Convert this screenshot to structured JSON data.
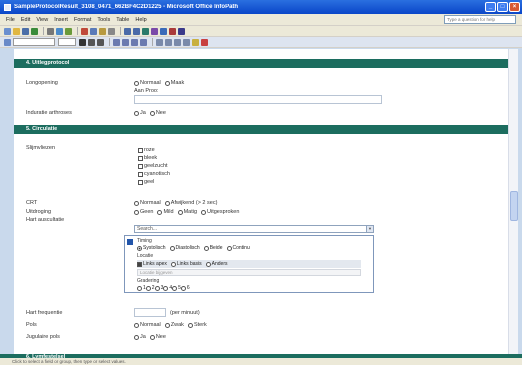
{
  "window": {
    "title": "SampleProtocolResult_3108_0471_662BF4C2D1225 - Microsoft Office InfoPath"
  },
  "menu": {
    "items": [
      "File",
      "Edit",
      "View",
      "Insert",
      "Format",
      "Tools",
      "Table",
      "Help"
    ],
    "help_placeholder": "Type a question for help"
  },
  "sections": {
    "s4": "4. Uitlegprotocol",
    "s5": "5. Circulatie",
    "s6": "6. Lymfestelsel"
  },
  "fields": {
    "longopening": {
      "label": "Longopening",
      "options": [
        "Normaal",
        "Maak"
      ],
      "extra_label": "Aan Proo:"
    },
    "induratie": {
      "label": "Induratie arthroses",
      "options": [
        "Ja",
        "Nee"
      ]
    },
    "slijmvliezen": {
      "label": "Slijmvliezen",
      "options": [
        "roze",
        "bleek",
        "geelzucht",
        "cyanotisch",
        "geel"
      ]
    },
    "crt": {
      "label": "CRT",
      "options": [
        "Normaal",
        "Afwijkend (> 2 sec)"
      ]
    },
    "uitdroging": {
      "label": "Uitdroging",
      "options": [
        "Geen",
        "Mild",
        "Matig",
        "Uitgesproken"
      ]
    },
    "hartauscultatie": {
      "label": "Hart auscultatie",
      "search_placeholder": "Search...",
      "popup": {
        "timing_label": "Timing",
        "timing_options": [
          "Systolisch",
          "Diastolisch",
          "Beide",
          "Continu"
        ],
        "locatie_label": "Locatie",
        "locatie_options": [
          "Links apex",
          "Links basis",
          "Anders"
        ],
        "locatie_input": "Locatie bijgeven",
        "gradering_label": "Gradering",
        "gradering_options": [
          "1",
          "2",
          "3",
          "4",
          "5",
          "6"
        ]
      }
    },
    "hartfrequentie": {
      "label": "Hart frequentie",
      "unit": "(per minuut)"
    },
    "pols": {
      "label": "Pols",
      "options": [
        "Normaal",
        "Zwak",
        "Sterk"
      ]
    },
    "jugulaire": {
      "label": "Jugulaire pols",
      "options": [
        "Ja",
        "Nee"
      ]
    }
  },
  "status": {
    "text": "Click to select a field or group, then type or select values."
  }
}
